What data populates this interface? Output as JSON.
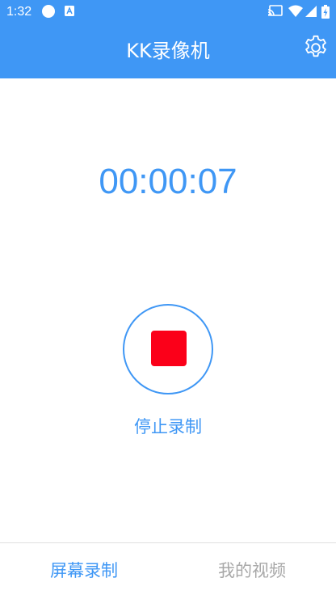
{
  "status_bar": {
    "time": "1:32",
    "icons": [
      "notification-circle-icon",
      "app-a-icon",
      "cast-icon",
      "wifi-icon",
      "signal-icon",
      "battery-charging-icon"
    ]
  },
  "app_bar": {
    "title": "KK录像机",
    "settings_icon": "gear-icon"
  },
  "recording": {
    "elapsed": "00:00:07",
    "stop_label": "停止录制",
    "stop_icon": "stop-square-icon"
  },
  "bottom_nav": {
    "tabs": [
      {
        "label": "屏幕录制",
        "active": true
      },
      {
        "label": "我的视频",
        "active": false
      }
    ]
  },
  "colors": {
    "primary": "#3f97f5",
    "stop": "#fb0019",
    "inactive_text": "#a8a8a8"
  }
}
